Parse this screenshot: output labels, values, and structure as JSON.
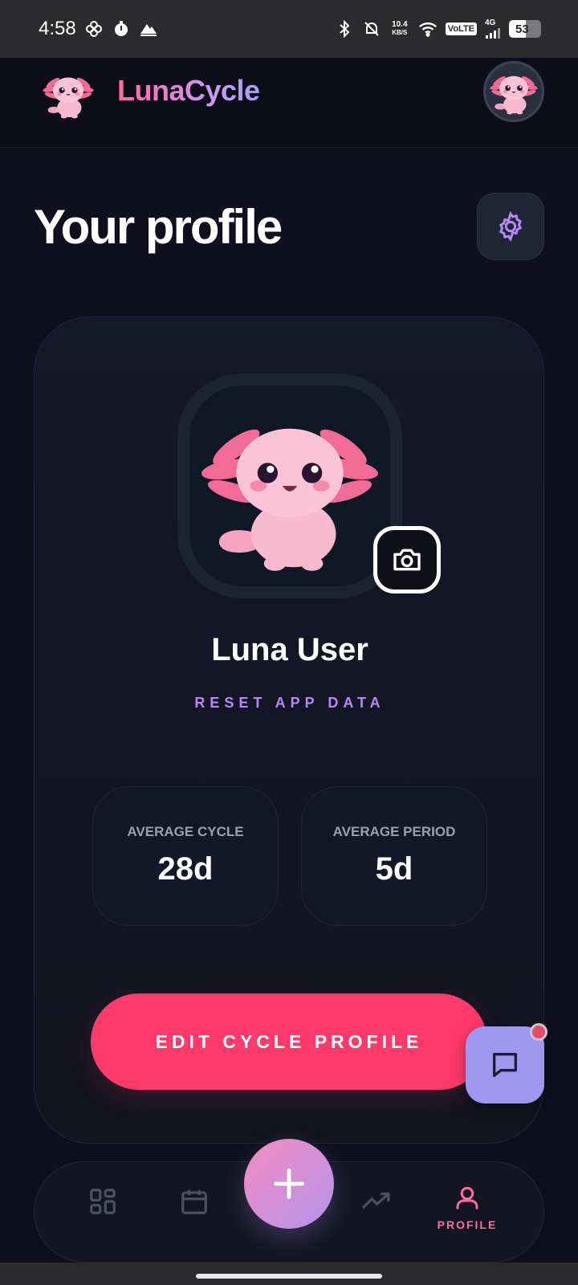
{
  "status_bar": {
    "time": "4:58",
    "net_speed_value": "10.4",
    "net_speed_unit": "KB/S",
    "volte": "VoLTE",
    "network": "4G",
    "battery": "53",
    "battery_level": 0.53
  },
  "app": {
    "name": "LunaCycle"
  },
  "page": {
    "title": "Your profile"
  },
  "profile": {
    "name": "Luna User",
    "reset_label": "RESET APP DATA",
    "stats": [
      {
        "label": "AVERAGE CYCLE",
        "value": "28d"
      },
      {
        "label": "AVERAGE PERIOD",
        "value": "5d"
      }
    ],
    "edit_button_label": "EDIT CYCLE PROFILE"
  },
  "bottom_nav": {
    "items": [
      {
        "icon": "grid-icon",
        "label": ""
      },
      {
        "icon": "calendar-icon",
        "label": ""
      },
      {
        "icon": "plus-icon",
        "label": ""
      },
      {
        "icon": "trending-up-icon",
        "label": ""
      },
      {
        "icon": "person-icon",
        "label": "PROFILE"
      }
    ],
    "active": "PROFILE"
  },
  "colors": {
    "accent_pink": "#fd3a6a",
    "accent_purple": "#b987f5",
    "background": "#0f0f1d"
  }
}
